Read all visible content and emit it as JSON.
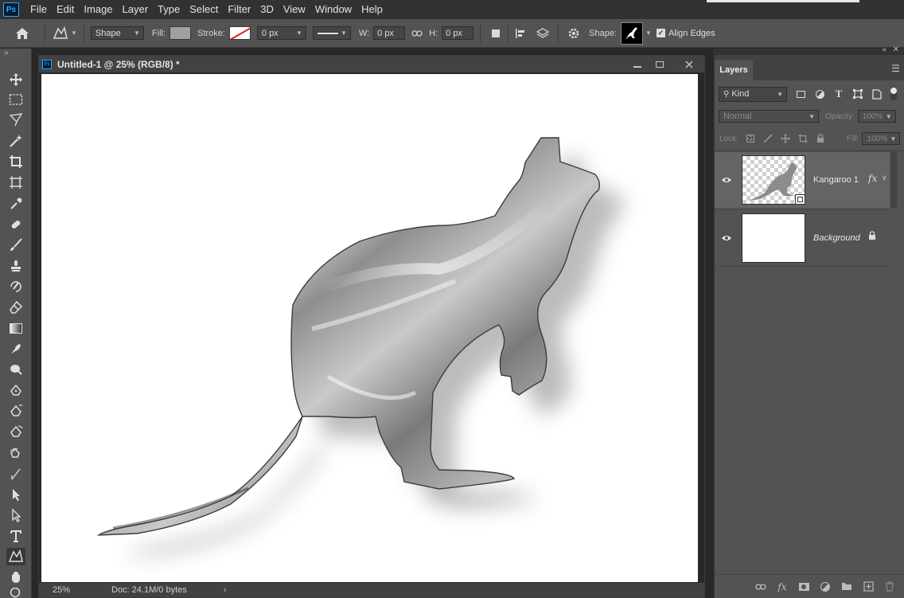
{
  "app": {
    "logo": "Ps"
  },
  "menu": [
    "File",
    "Edit",
    "Image",
    "Layer",
    "Type",
    "Select",
    "Filter",
    "3D",
    "View",
    "Window",
    "Help"
  ],
  "options": {
    "shape_mode": "Shape",
    "fill_label": "Fill:",
    "fill_color": "#a0a0a0",
    "stroke_label": "Stroke:",
    "stroke_width": "0 px",
    "w_label": "W:",
    "w_value": "0 px",
    "h_label": "H:",
    "h_value": "0 px",
    "shape_label": "Shape:",
    "align_edges_label": "Align Edges",
    "align_edges_checked": true
  },
  "document": {
    "title": "Untitled-1 @ 25% (RGB/8) *",
    "zoom": "25%",
    "doc_info": "Doc: 24.1M/0 bytes"
  },
  "layers_panel": {
    "tab": "Layers",
    "filter_kind": "Kind",
    "blend_mode": "Normal",
    "opacity_label": "Opacity:",
    "opacity_value": "100%",
    "lock_label": "Lock:",
    "fill_label": "Fill:",
    "fill_value": "100%",
    "layers": [
      {
        "name": "Kangaroo 1",
        "visible": true,
        "has_fx": true,
        "selected": true
      },
      {
        "name": "Background",
        "visible": true,
        "locked": true,
        "selected": false
      }
    ]
  },
  "icons": {
    "toolbar": [
      "move-icon",
      "marquee-icon",
      "lasso-icon",
      "magic-wand-icon",
      "crop-icon",
      "frame-icon",
      "eyedropper-icon",
      "healing-icon",
      "brush-icon",
      "stamp-icon",
      "history-brush-icon",
      "eraser-icon",
      "gradient-icon",
      "smudge-icon",
      "dodge-icon",
      "pen-icon",
      "freeform-pen-icon",
      "curvature-pen-icon",
      "add-anchor-icon",
      "path-selection-icon",
      "direct-selection-icon",
      "type-icon",
      "custom-shape-icon",
      "hand-icon",
      "zoom-icon"
    ]
  }
}
